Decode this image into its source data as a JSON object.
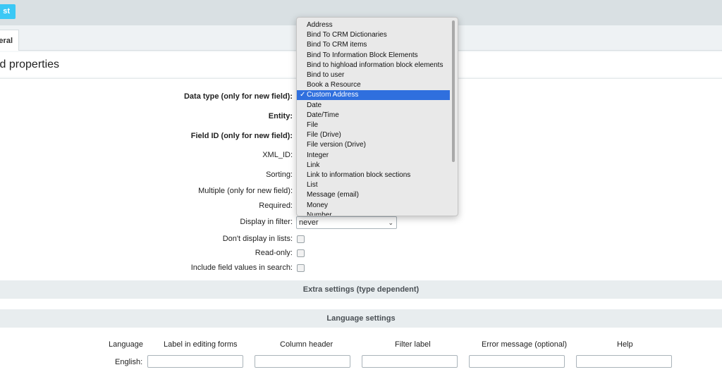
{
  "topbar": {
    "button_label": "st"
  },
  "tabs": {
    "general_label": "eral"
  },
  "page": {
    "title": "ld properties"
  },
  "form": {
    "data_type_label": "Data type (only for new field):",
    "entity_label": "Entity:",
    "field_id_label": "Field ID (only for new field):",
    "xml_id_label": "XML_ID:",
    "sorting_label": "Sorting:",
    "multiple_label": "Multiple (only for new field):",
    "required_label": "Required:",
    "display_filter_label": "Display in filter:",
    "display_filter_value": "never",
    "dont_display_label": "Don't display in lists:",
    "readonly_label": "Read-only:",
    "include_search_label": "Include field values in search:"
  },
  "sections": {
    "extra_settings": "Extra settings (type dependent)",
    "language_settings": "Language settings"
  },
  "language_table": {
    "columns": [
      "Language",
      "Label in editing forms",
      "Column header",
      "Filter label",
      "Error message (optional)",
      "Help"
    ],
    "rows": [
      {
        "language": "English:"
      }
    ]
  },
  "dropdown": {
    "items": [
      "Address",
      "Bind To CRM Dictionaries",
      "Bind To CRM items",
      "Bind To Information Block Elements",
      "Bind to highload information block elements",
      "Bind to user",
      "Book a Resource",
      "Custom Address",
      "Date",
      "Date/Time",
      "File",
      "File (Drive)",
      "File version (Drive)",
      "Integer",
      "Link",
      "Link to information block sections",
      "List",
      "Message (email)",
      "Money",
      "Number"
    ],
    "selected": "Custom Address",
    "check_mark": "✓"
  },
  "icons": {
    "select_chevron": "chevron-down-icon"
  }
}
